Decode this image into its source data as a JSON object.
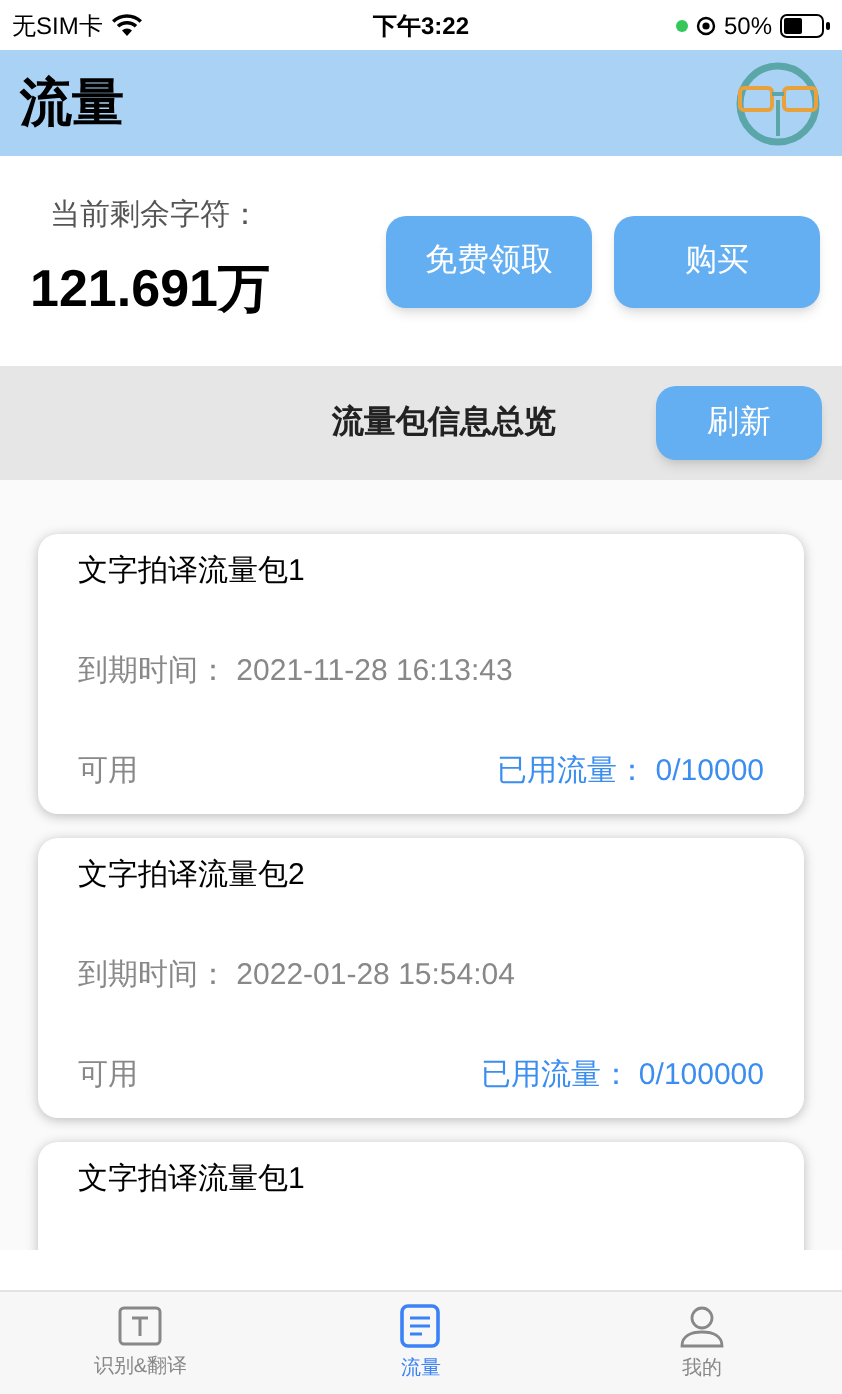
{
  "status_bar": {
    "carrier": "无SIM卡",
    "time": "下午3:22",
    "battery": "50%"
  },
  "header": {
    "title": "流量"
  },
  "balance": {
    "label": "当前剩余字符：",
    "value": "121.691万",
    "buttons": [
      "免费领取",
      "购买"
    ]
  },
  "overview": {
    "title": "流量包信息总览",
    "refresh_button": "刷新"
  },
  "packages": [
    {
      "name": "文字拍译流量包1",
      "expiry": "到期时间：  2021-11-28 16:13:43",
      "status": "可用",
      "usage": "已用流量：  0/10000"
    },
    {
      "name": "文字拍译流量包2",
      "expiry": "到期时间：  2022-01-28 15:54:04",
      "status": "可用",
      "usage": "已用流量：  0/100000"
    },
    {
      "name": "文字拍译流量包1"
    }
  ],
  "tabs": [
    {
      "label": "识别&翻译",
      "kind": "text",
      "selected": false
    },
    {
      "label": "流量",
      "kind": "list",
      "selected": true
    },
    {
      "label": "我的",
      "kind": "person",
      "selected": false
    }
  ]
}
